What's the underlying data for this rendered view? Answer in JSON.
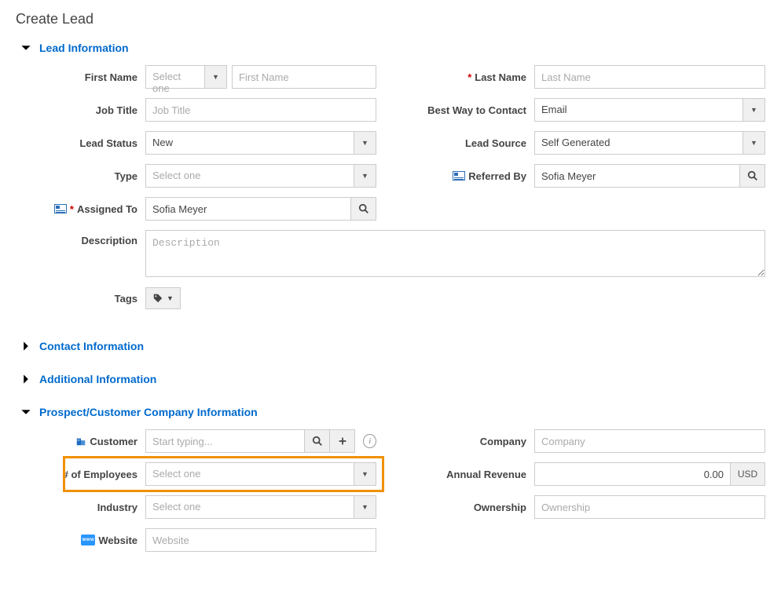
{
  "page_title": "Create Lead",
  "sections": {
    "lead_info": {
      "title": "Lead Information",
      "expanded": true
    },
    "contact_info": {
      "title": "Contact Information",
      "expanded": false
    },
    "additional_info": {
      "title": "Additional Information",
      "expanded": false
    },
    "company_info": {
      "title": "Prospect/Customer Company Information",
      "expanded": true
    }
  },
  "labels": {
    "first_name": "First Name",
    "last_name": "Last Name",
    "job_title": "Job Title",
    "best_contact": "Best Way to Contact",
    "lead_status": "Lead Status",
    "lead_source": "Lead Source",
    "type": "Type",
    "referred_by": "Referred By",
    "assigned_to": "Assigned To",
    "description": "Description",
    "tags": "Tags",
    "customer": "Customer",
    "company": "Company",
    "num_employees": "# of Employees",
    "annual_revenue": "Annual Revenue",
    "industry": "Industry",
    "ownership": "Ownership",
    "website": "Website"
  },
  "placeholders": {
    "select_one": "Select one",
    "first_name": "First Name",
    "last_name": "Last Name",
    "job_title": "Job Title",
    "description": "Description",
    "start_typing": "Start typing...",
    "company": "Company",
    "ownership": "Ownership",
    "website": "Website"
  },
  "values": {
    "first_name_prefix": "Select one",
    "lead_status": "New",
    "best_contact": "Email",
    "lead_source": "Self Generated",
    "referred_by": "Sofia Meyer",
    "assigned_to": "Sofia Meyer",
    "annual_revenue": "0.00",
    "currency": "USD"
  }
}
